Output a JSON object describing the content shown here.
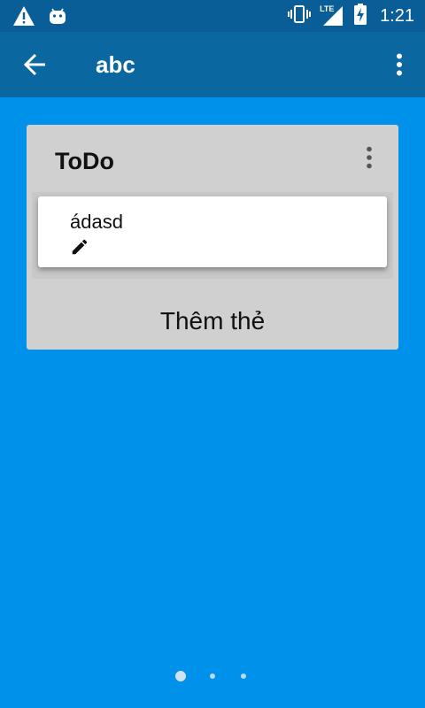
{
  "status_bar": {
    "time": "1:21",
    "network": "LTE",
    "icons": [
      "warning-icon",
      "android-icon",
      "vibrate-icon",
      "signal-icon",
      "battery-charging-icon"
    ]
  },
  "app_bar": {
    "title": "abc",
    "back_icon": "arrow-back-icon",
    "menu_icon": "more-vert-icon"
  },
  "list": {
    "title": "ToDo",
    "menu_icon": "more-vert-icon",
    "cards": [
      {
        "title": "ádasd",
        "icon": "edit-pencil-icon"
      }
    ],
    "add_card_label": "Thêm thẻ"
  },
  "page_indicator": {
    "total": 3,
    "active_index": 0
  },
  "colors": {
    "background": "#0091EA",
    "status_bar": "#0A5E97",
    "app_bar": "#0A679F",
    "list_bg": "#D0D0D0",
    "card_bg": "#FFFFFF"
  }
}
